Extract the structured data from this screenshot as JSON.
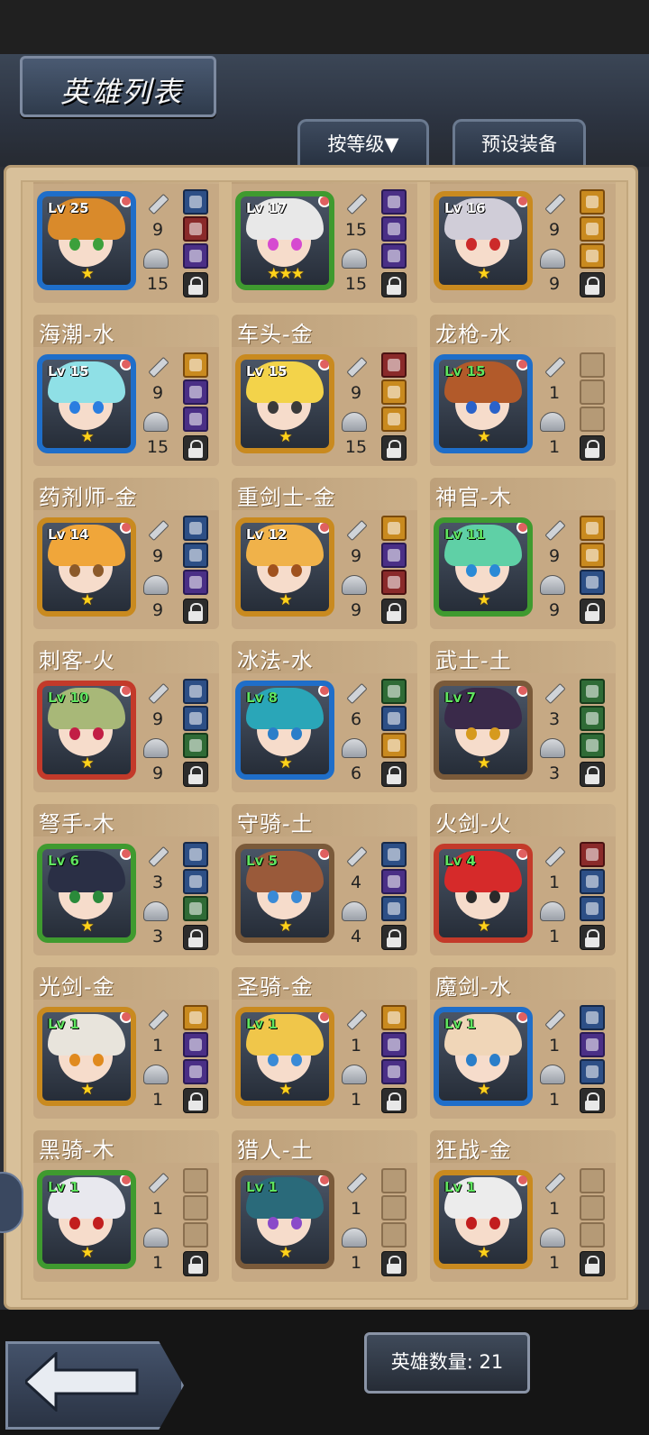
{
  "header": {
    "title": "英雄列表",
    "sort_button": "按等级▼",
    "preset_button": "预设装备"
  },
  "footer": {
    "hero_count_label": "英雄数量: 21"
  },
  "heroes": [
    {
      "name": "",
      "level": "Lv 25",
      "atk": "9",
      "def": "15",
      "stars": "★",
      "frame": "#1f6ec9",
      "hair": "#d98a2b",
      "eye": "#3ca03c",
      "lv_green": false,
      "slots": [
        "blue",
        "red",
        "purple"
      ]
    },
    {
      "name": "",
      "level": "Lv 17",
      "atk": "15",
      "def": "15",
      "stars": "★★★",
      "frame": "#3f9a2f",
      "hair": "#e8e8e8",
      "eye": "#d64ad0",
      "lv_green": false,
      "slots": [
        "purple",
        "purple",
        "purple"
      ]
    },
    {
      "name": "",
      "level": "Lv 16",
      "atk": "9",
      "def": "9",
      "stars": "★",
      "frame": "#c98a1f",
      "hair": "#d0cdd8",
      "eye": "#cc2a2a",
      "lv_green": false,
      "slots": [
        "gold",
        "gold",
        "gold"
      ]
    },
    {
      "name": "海潮-水",
      "level": "Lv 15",
      "atk": "9",
      "def": "15",
      "stars": "★",
      "frame": "#1f6ec9",
      "hair": "#8fe0e6",
      "eye": "#2a7ee0",
      "lv_green": false,
      "slots": [
        "gold",
        "purple",
        "purple"
      ]
    },
    {
      "name": "车头-金",
      "level": "Lv 15",
      "atk": "9",
      "def": "15",
      "stars": "★",
      "frame": "#c98a1f",
      "hair": "#f3d34a",
      "eye": "#3a3a3a",
      "lv_green": false,
      "slots": [
        "red",
        "gold",
        "gold"
      ]
    },
    {
      "name": "龙枪-水",
      "level": "Lv 15",
      "atk": "1",
      "def": "1",
      "stars": "★",
      "frame": "#1f6ec9",
      "hair": "#b25a2a",
      "eye": "#2a62c9",
      "lv_green": true,
      "slots": [
        "empty",
        "empty",
        "empty"
      ]
    },
    {
      "name": "药剂师-金",
      "level": "Lv 14",
      "atk": "9",
      "def": "9",
      "stars": "★",
      "frame": "#c98a1f",
      "hair": "#f0a63a",
      "eye": "#8c5a2a",
      "lv_green": false,
      "slots": [
        "blue",
        "blue",
        "purple"
      ]
    },
    {
      "name": "重剑士-金",
      "level": "Lv 12",
      "atk": "9",
      "def": "9",
      "stars": "★",
      "frame": "#c98a1f",
      "hair": "#f0b24a",
      "eye": "#a0521e",
      "lv_green": false,
      "slots": [
        "gold",
        "purple",
        "red"
      ]
    },
    {
      "name": "神官-木",
      "level": "Lv 11",
      "atk": "9",
      "def": "9",
      "stars": "★",
      "frame": "#3f9a2f",
      "hair": "#5fd0a6",
      "eye": "#2a8ad6",
      "lv_green": true,
      "slots": [
        "gold",
        "gold",
        "blue"
      ]
    },
    {
      "name": "刺客-火",
      "level": "Lv 10",
      "atk": "9",
      "def": "9",
      "stars": "★",
      "frame": "#c33a2a",
      "hair": "#a8b878",
      "eye": "#c21e45",
      "lv_green": true,
      "slots": [
        "blue",
        "blue",
        "green"
      ]
    },
    {
      "name": "冰法-水",
      "level": "Lv 8",
      "atk": "6",
      "def": "6",
      "stars": "★",
      "frame": "#1f6ec9",
      "hair": "#2aa6b8",
      "eye": "#2a7ec9",
      "lv_green": true,
      "slots": [
        "green",
        "blue",
        "gold"
      ]
    },
    {
      "name": "武士-土",
      "level": "Lv 7",
      "atk": "3",
      "def": "3",
      "stars": "★",
      "frame": "#7a5a3a",
      "hair": "#3a2a4a",
      "eye": "#d69a1e",
      "lv_green": true,
      "slots": [
        "green",
        "green",
        "green"
      ]
    },
    {
      "name": "弩手-木",
      "level": "Lv 6",
      "atk": "3",
      "def": "3",
      "stars": "★",
      "frame": "#3f9a2f",
      "hair": "#2a2f45",
      "eye": "#2a8a3a",
      "lv_green": true,
      "slots": [
        "blue",
        "blue",
        "green"
      ]
    },
    {
      "name": "守骑-土",
      "level": "Lv 5",
      "atk": "4",
      "def": "4",
      "stars": "★",
      "frame": "#7a5a3a",
      "hair": "#9a5a3a",
      "eye": "#3a8ad6",
      "lv_green": true,
      "slots": [
        "blue",
        "purple",
        "blue"
      ]
    },
    {
      "name": "火剑-火",
      "level": "Lv 4",
      "atk": "1",
      "def": "1",
      "stars": "★",
      "frame": "#c33a2a",
      "hair": "#d62a2a",
      "eye": "#2a2a2a",
      "lv_green": true,
      "slots": [
        "red",
        "blue",
        "blue"
      ]
    },
    {
      "name": "光剑-金",
      "level": "Lv 1",
      "atk": "1",
      "def": "1",
      "stars": "★",
      "frame": "#c98a1f",
      "hair": "#e8e4dc",
      "eye": "#e08a1e",
      "lv_green": true,
      "slots": [
        "gold",
        "purple",
        "purple"
      ]
    },
    {
      "name": "圣骑-金",
      "level": "Lv 1",
      "atk": "1",
      "def": "1",
      "stars": "★",
      "frame": "#c98a1f",
      "hair": "#f0c64a",
      "eye": "#3a8ad6",
      "lv_green": true,
      "slots": [
        "gold",
        "purple",
        "purple"
      ]
    },
    {
      "name": "魔剑-水",
      "level": "Lv 1",
      "atk": "1",
      "def": "1",
      "stars": "★",
      "frame": "#1f6ec9",
      "hair": "#f0d6b8",
      "eye": "#2a7ec9",
      "lv_green": true,
      "slots": [
        "blue",
        "purple",
        "blue"
      ]
    },
    {
      "name": "黑骑-木",
      "level": "Lv 1",
      "atk": "1",
      "def": "1",
      "stars": "★",
      "frame": "#3f9a2f",
      "hair": "#e8e8ee",
      "eye": "#c21e1e",
      "lv_green": true,
      "slots": [
        "empty",
        "empty",
        "empty"
      ]
    },
    {
      "name": "猎人-土",
      "level": "Lv 1",
      "atk": "1",
      "def": "1",
      "stars": "★",
      "frame": "#7a5a3a",
      "hair": "#2a6a7a",
      "eye": "#8a4ac9",
      "lv_green": true,
      "slots": [
        "empty",
        "empty",
        "empty"
      ]
    },
    {
      "name": "狂战-金",
      "level": "Lv 1",
      "atk": "1",
      "def": "1",
      "stars": "★",
      "frame": "#c98a1f",
      "hair": "#ececec",
      "eye": "#c21e1e",
      "lv_green": true,
      "slots": [
        "empty",
        "empty",
        "empty"
      ]
    }
  ]
}
